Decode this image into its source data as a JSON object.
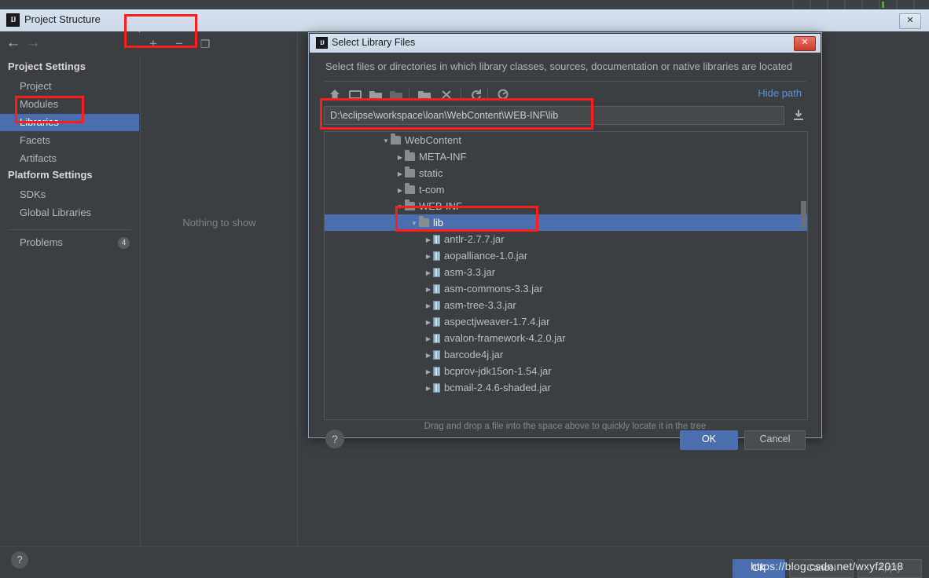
{
  "main_window": {
    "title": "Project Structure",
    "logo_text": "IJ",
    "close_label": "✕",
    "nav": {
      "back_icon": "←",
      "forward_icon": "→"
    },
    "sidebar": {
      "project_settings_header": "Project Settings",
      "platform_settings_header": "Platform Settings",
      "project_items": [
        {
          "label": "Project",
          "selected": false
        },
        {
          "label": "Modules",
          "selected": false
        },
        {
          "label": "Libraries",
          "selected": true
        },
        {
          "label": "Facets",
          "selected": false
        },
        {
          "label": "Artifacts",
          "selected": false
        }
      ],
      "platform_items": [
        {
          "label": "SDKs",
          "selected": false
        },
        {
          "label": "Global Libraries",
          "selected": false
        }
      ],
      "problems": {
        "label": "Problems",
        "count": "4"
      }
    },
    "center_toolbar": {
      "add_label": "+",
      "remove_label": "−",
      "copy_label": "❐"
    },
    "center_pane": {
      "empty_text": "Nothing to show"
    },
    "bottom": {
      "help_label": "?",
      "ok_label": "OK",
      "cancel_label": "Cancel",
      "apply_label": "Apply",
      "watermark": "https://blog.csdn.net/wxyf2018"
    }
  },
  "dialog": {
    "title": "Select Library Files",
    "logo_text": "IJ",
    "close_label": "✕",
    "subtitle": "Select files or directories in which library classes, sources, documentation or native libraries are located",
    "toolbar": {
      "icons": [
        {
          "name": "home-icon"
        },
        {
          "name": "desktop-icon"
        },
        {
          "name": "folder-up-icon"
        },
        {
          "name": "folder-icon"
        },
        {
          "name": "new-folder-icon"
        },
        {
          "name": "delete-icon"
        },
        {
          "name": "refresh-icon"
        },
        {
          "name": "show-hidden-icon"
        }
      ],
      "hide_path_label": "Hide path"
    },
    "path_value": "D:\\eclipse\\workspace\\loan\\WebContent\\WEB-INF\\lib",
    "path_download_icon": "download-icon",
    "tree": [
      {
        "label": "WebContent",
        "indent": 4,
        "type": "folder",
        "twist": "down",
        "selected": false
      },
      {
        "label": "META-INF",
        "indent": 5,
        "type": "folder",
        "twist": "right",
        "selected": false
      },
      {
        "label": "static",
        "indent": 5,
        "type": "folder",
        "twist": "right",
        "selected": false
      },
      {
        "label": "t-com",
        "indent": 5,
        "type": "folder",
        "twist": "right",
        "selected": false
      },
      {
        "label": "WEB-INF",
        "indent": 5,
        "type": "folder",
        "twist": "down",
        "selected": false
      },
      {
        "label": "lib",
        "indent": 6,
        "type": "folder",
        "twist": "down",
        "selected": true
      },
      {
        "label": "antlr-2.7.7.jar",
        "indent": 7,
        "type": "jar",
        "twist": "right",
        "selected": false
      },
      {
        "label": "aopalliance-1.0.jar",
        "indent": 7,
        "type": "jar",
        "twist": "right",
        "selected": false
      },
      {
        "label": "asm-3.3.jar",
        "indent": 7,
        "type": "jar",
        "twist": "right",
        "selected": false
      },
      {
        "label": "asm-commons-3.3.jar",
        "indent": 7,
        "type": "jar",
        "twist": "right",
        "selected": false
      },
      {
        "label": "asm-tree-3.3.jar",
        "indent": 7,
        "type": "jar",
        "twist": "right",
        "selected": false
      },
      {
        "label": "aspectjweaver-1.7.4.jar",
        "indent": 7,
        "type": "jar",
        "twist": "right",
        "selected": false
      },
      {
        "label": "avalon-framework-4.2.0.jar",
        "indent": 7,
        "type": "jar",
        "twist": "right",
        "selected": false
      },
      {
        "label": "barcode4j.jar",
        "indent": 7,
        "type": "jar",
        "twist": "right",
        "selected": false
      },
      {
        "label": "bcprov-jdk15on-1.54.jar",
        "indent": 7,
        "type": "jar",
        "twist": "right",
        "selected": false
      },
      {
        "label": "bcmail-2.4.6-shaded.jar",
        "indent": 7,
        "type": "jar",
        "twist": "right",
        "selected": false
      }
    ],
    "drag_hint": "Drag and drop a file into the space above to quickly locate it in the tree",
    "help_label": "?",
    "ok_label": "OK",
    "cancel_label": "Cancel"
  },
  "annotations": {
    "accent_color": "#ff1c1c",
    "boxes": [
      {
        "name": "add-remove-toolbar-highlight"
      },
      {
        "name": "libraries-item-highlight"
      },
      {
        "name": "path-field-highlight"
      },
      {
        "name": "lib-node-highlight"
      }
    ]
  }
}
